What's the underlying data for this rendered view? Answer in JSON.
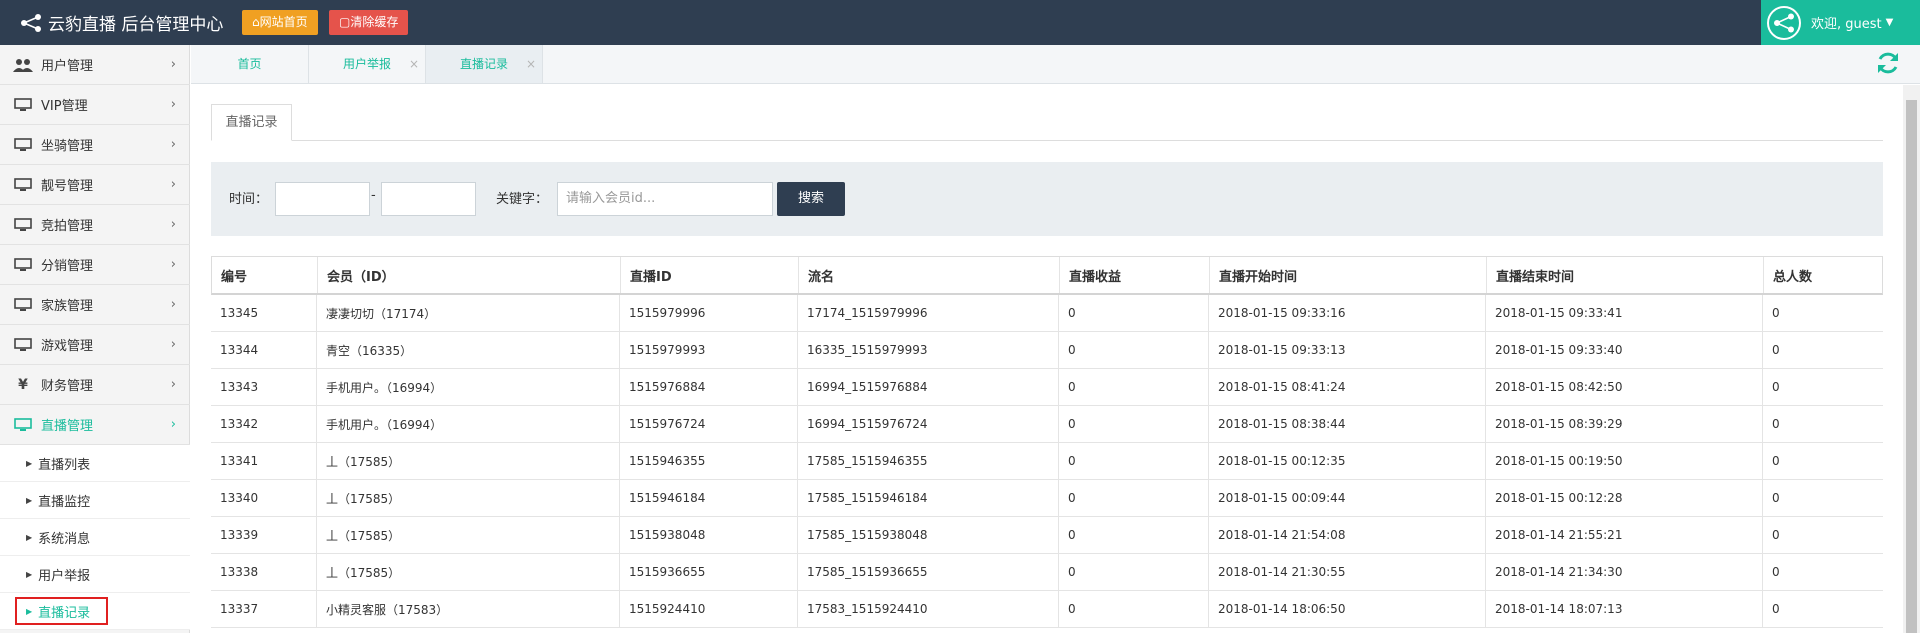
{
  "header": {
    "brand": "云豹直播 后台管理中心",
    "home_button": "网站首页",
    "clear_cache_button": "清除缓存",
    "welcome": "欢迎, guest"
  },
  "sidebar": {
    "items": [
      {
        "label": "用户管理",
        "icon": "users-icon"
      },
      {
        "label": "VIP管理",
        "icon": "monitor-icon"
      },
      {
        "label": "坐骑管理",
        "icon": "monitor-icon"
      },
      {
        "label": "靓号管理",
        "icon": "monitor-icon"
      },
      {
        "label": "竞拍管理",
        "icon": "monitor-icon"
      },
      {
        "label": "分销管理",
        "icon": "monitor-icon"
      },
      {
        "label": "家族管理",
        "icon": "monitor-icon"
      },
      {
        "label": "游戏管理",
        "icon": "monitor-icon"
      },
      {
        "label": "财务管理",
        "icon": "yen-icon"
      },
      {
        "label": "直播管理",
        "icon": "monitor-icon"
      }
    ],
    "sub_items": [
      {
        "label": "直播列表"
      },
      {
        "label": "直播监控"
      },
      {
        "label": "系统消息"
      },
      {
        "label": "用户举报"
      },
      {
        "label": "直播记录"
      }
    ]
  },
  "tabs": [
    {
      "label": "首页"
    },
    {
      "label": "用户举报"
    },
    {
      "label": "直播记录"
    }
  ],
  "content_tab": "直播记录",
  "filter": {
    "time_label": "时间：",
    "dash": "-",
    "keyword_label": "关键字：",
    "keyword_placeholder": "请输入会员id...",
    "search_button": "搜索"
  },
  "table": {
    "columns": [
      "编号",
      "会员（ID）",
      "直播ID",
      "流名",
      "直播收益",
      "直播开始时间",
      "直播结束时间",
      "总人数"
    ],
    "rows": [
      [
        "13345",
        "凄凄切切（17174）",
        "1515979996",
        "17174_1515979996",
        "0",
        "2018-01-15 09:33:16",
        "2018-01-15 09:33:41",
        "0"
      ],
      [
        "13344",
        "青空（16335）",
        "1515979993",
        "16335_1515979993",
        "0",
        "2018-01-15 09:33:13",
        "2018-01-15 09:33:40",
        "0"
      ],
      [
        "13343",
        "手机用户。（16994）",
        "1515976884",
        "16994_1515976884",
        "0",
        "2018-01-15 08:41:24",
        "2018-01-15 08:42:50",
        "0"
      ],
      [
        "13342",
        "手机用户。（16994）",
        "1515976724",
        "16994_1515976724",
        "0",
        "2018-01-15 08:38:44",
        "2018-01-15 08:39:29",
        "0"
      ],
      [
        "13341",
        "丄（17585）",
        "1515946355",
        "17585_1515946355",
        "0",
        "2018-01-15 00:12:35",
        "2018-01-15 00:19:50",
        "0"
      ],
      [
        "13340",
        "丄（17585）",
        "1515946184",
        "17585_1515946184",
        "0",
        "2018-01-15 00:09:44",
        "2018-01-15 00:12:28",
        "0"
      ],
      [
        "13339",
        "丄（17585）",
        "1515938048",
        "17585_1515938048",
        "0",
        "2018-01-14 21:54:08",
        "2018-01-14 21:55:21",
        "0"
      ],
      [
        "13338",
        "丄（17585）",
        "1515936655",
        "17585_1515936655",
        "0",
        "2018-01-14 21:30:55",
        "2018-01-14 21:34:30",
        "0"
      ],
      [
        "13337",
        "小精灵客服（17583）",
        "1515924410",
        "17583_1515924410",
        "0",
        "2018-01-14 18:06:50",
        "2018-01-14 18:07:13",
        "0"
      ]
    ]
  },
  "colors": {
    "header_bg": "#2f3e51",
    "accent": "#1abc9c",
    "home_button": "#f0a022",
    "clear_cache_button": "#e5534b",
    "highlight_border": "#e02020"
  }
}
